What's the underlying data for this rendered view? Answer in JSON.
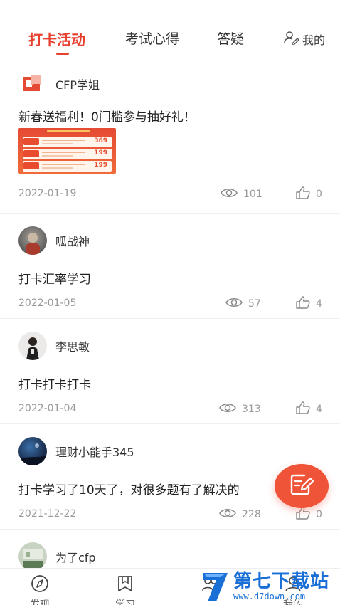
{
  "tabs": {
    "items": [
      {
        "label": "打卡活动",
        "active": true
      },
      {
        "label": "考试心得",
        "active": false
      },
      {
        "label": "答疑",
        "active": false
      },
      {
        "label": "我的",
        "icon": "user-edit-icon",
        "active": false
      }
    ]
  },
  "posts": [
    {
      "author": "CFP学姐",
      "text": "新春送福利！0门槛参与抽好礼！",
      "date": "2022-01-19",
      "views": "101",
      "likes": "0",
      "poster_prices": [
        "369",
        "199",
        "199"
      ]
    },
    {
      "author": "呱战神",
      "text": "打卡汇率学习",
      "date": "2022-01-05",
      "views": "57",
      "likes": "4"
    },
    {
      "author": "李思敏",
      "text": "打卡打卡打卡",
      "date": "2022-01-04",
      "views": "313",
      "likes": "4"
    },
    {
      "author": "理财小能手345",
      "text": "打卡学习了10天了，对很多题有了解决的",
      "date": "2021-12-22",
      "views": "228",
      "likes": "0"
    },
    {
      "author": "为了cfp"
    }
  ],
  "bottom_nav": {
    "items": [
      {
        "label": "发现",
        "icon": "compass-icon"
      },
      {
        "label": "学习",
        "icon": "book-icon"
      },
      {
        "label": "",
        "icon": "group-icon"
      },
      {
        "label": "我的",
        "icon": "profile-icon"
      }
    ]
  },
  "watermark": {
    "title": "第七下载站",
    "url": "www.d7down.com"
  },
  "colors": {
    "accent": "#e8402f",
    "fab": "#f05438",
    "muted": "#999999",
    "watermark": "#1a6fd6"
  }
}
